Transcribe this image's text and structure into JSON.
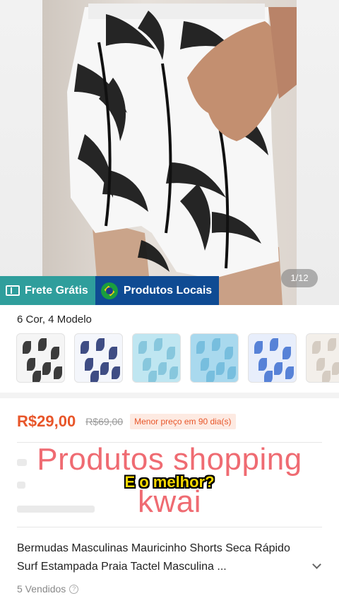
{
  "gallery": {
    "counter": "1/12"
  },
  "badges": {
    "frete": "Frete Grátis",
    "locais": "Produtos Locais"
  },
  "variants": {
    "title": "6 Cor, 4 Modelo",
    "thumbs": [
      {
        "bg": "#f5f5f5",
        "leaf": "#1b1b1b"
      },
      {
        "bg": "#f4f6fb",
        "leaf": "#1e2f6e"
      },
      {
        "bg": "#bfe6f1",
        "leaf": "#7cc1d9"
      },
      {
        "bg": "#a9d9ee",
        "leaf": "#6fb8db"
      },
      {
        "bg": "#e8eefb",
        "leaf": "#3d6fd0"
      },
      {
        "bg": "#f3efea",
        "leaf": "#cfc6bb"
      }
    ]
  },
  "price": {
    "current": "R$29,00",
    "old": "R$69,00",
    "badge": "Menor preço em 90 dia(s)"
  },
  "overlay": {
    "line1": "Produtos shopping",
    "line2": "kwai",
    "caption": "E o melhor?"
  },
  "product": {
    "title": "Bermudas Masculinas Mauricinho Shorts Seca Rápido Surf Estampada Praia Tactel Masculina ...",
    "sold": "5 Vendidos"
  },
  "colors": {
    "price": "#e8562a",
    "frete_bg": "#2f9e9c",
    "locais_bg": "#0f4b93",
    "overlay_text": "#ef6b72",
    "caption": "#f7d800"
  }
}
